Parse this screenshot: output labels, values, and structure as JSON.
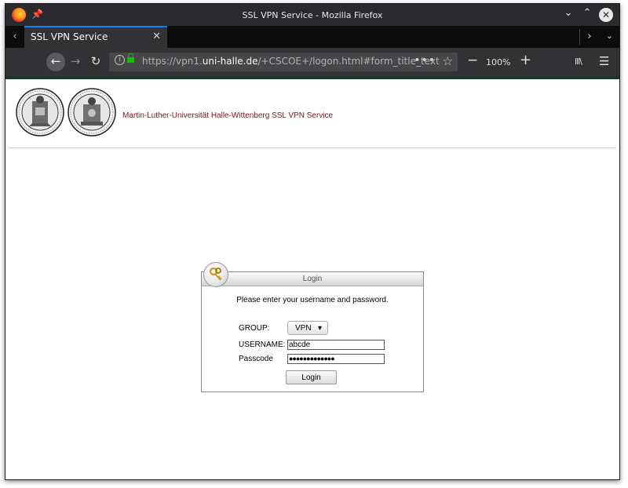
{
  "window": {
    "title": "SSL VPN Service - Mozilla Firefox",
    "minimize_glyph": "⌄",
    "maximize_glyph": "⌃",
    "close_glyph": "✕"
  },
  "tabs": [
    {
      "label": "SSL VPN Service",
      "active": true,
      "close_glyph": "✕"
    }
  ],
  "tabbar": {
    "scroll_left_glyph": "‹",
    "scroll_right_glyph": "›",
    "all_tabs_glyph": "⌄"
  },
  "navbar": {
    "back_glyph": "←",
    "forward_glyph": "→",
    "reload_glyph": "↻",
    "url_prefix": "https://vpn1.",
    "url_domain": "uni-halle.de",
    "url_suffix": "/+CSCOE+/logon.html#form_title_text",
    "page_actions_glyph": "•••",
    "bookmark_glyph": "☆",
    "zoom_out_glyph": "−",
    "zoom_level": "100%",
    "zoom_in_glyph": "+",
    "library_glyph": "lll\\",
    "menu_glyph": "☰"
  },
  "page": {
    "site_title": "Martin-Luther-Universität Halle-Wittenberg SSL VPN Service"
  },
  "login": {
    "header": "Login",
    "instructions": "Please enter your username and password.",
    "group_label": "GROUP:",
    "group_value": "VPN",
    "username_label": "USERNAME:",
    "username_value": "abcde",
    "passcode_label": "Passcode",
    "passcode_masked": "●●●●●●●●●●●●●",
    "submit_label": "Login"
  },
  "colors": {
    "accent_tab": "#0a84ff",
    "page_accent_bar": "#163833",
    "site_title": "#7a1418",
    "lock_green": "#12bc00"
  }
}
